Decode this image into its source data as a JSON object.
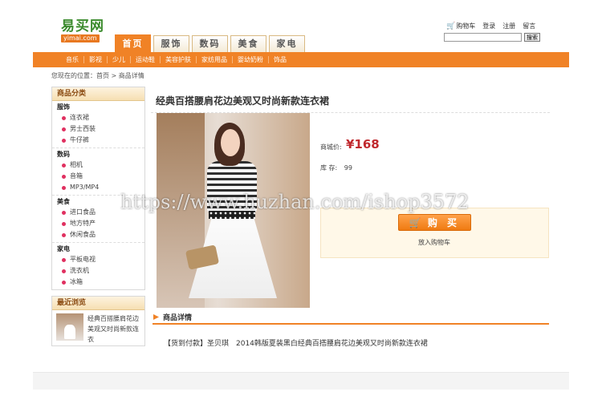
{
  "logo": {
    "cn": "易买网",
    "en": "yimai.com"
  },
  "top_links": {
    "cart": "购物车",
    "login": "登录",
    "register": "注册",
    "message": "留言"
  },
  "search": {
    "value": "",
    "button": "搜索"
  },
  "tabs": [
    "首页",
    "服饰",
    "数码",
    "美食",
    "家电"
  ],
  "nav": [
    "音乐",
    "影视",
    "少儿",
    "运动鞋",
    "美容护肤",
    "家纺用品",
    "婴幼奶粉",
    "饰品"
  ],
  "breadcrumb": "您现在的位置：首页 > 商品详情",
  "sidebar": {
    "category_title": "商品分类",
    "groups": [
      {
        "name": "服饰",
        "items": [
          "连衣裙",
          "男士西装",
          "牛仔裤"
        ]
      },
      {
        "name": "数码",
        "items": [
          "相机",
          "音箱",
          "MP3/MP4"
        ]
      },
      {
        "name": "美食",
        "items": [
          "进口食品",
          "地方特产",
          "休闲食品"
        ]
      },
      {
        "name": "家电",
        "items": [
          "平板电视",
          "洗衣机",
          "冰箱"
        ]
      }
    ],
    "recent_title": "最近浏览",
    "recent_item": "经典百搭腰肩花边美观又时尚新款连衣"
  },
  "product": {
    "title": "经典百搭腰肩花边美观又时尚新款连衣裙",
    "price_label": "商城价:",
    "price": "¥168",
    "stock_label": "库 存:",
    "stock": "99",
    "buy_label": "购 买",
    "fav_label": "放入购物车"
  },
  "detail": {
    "title": "商品详情",
    "text": "【货到付款】圣贝琪　2014韩版夏装黑白经典百搭腰肩花边美观又时尚新款连衣裙"
  },
  "watermark": "https://www.huzhan.com/ishop3572",
  "colors": {
    "accent": "#f08226",
    "price": "#c0282d",
    "logo_green": "#3a8a2c"
  }
}
